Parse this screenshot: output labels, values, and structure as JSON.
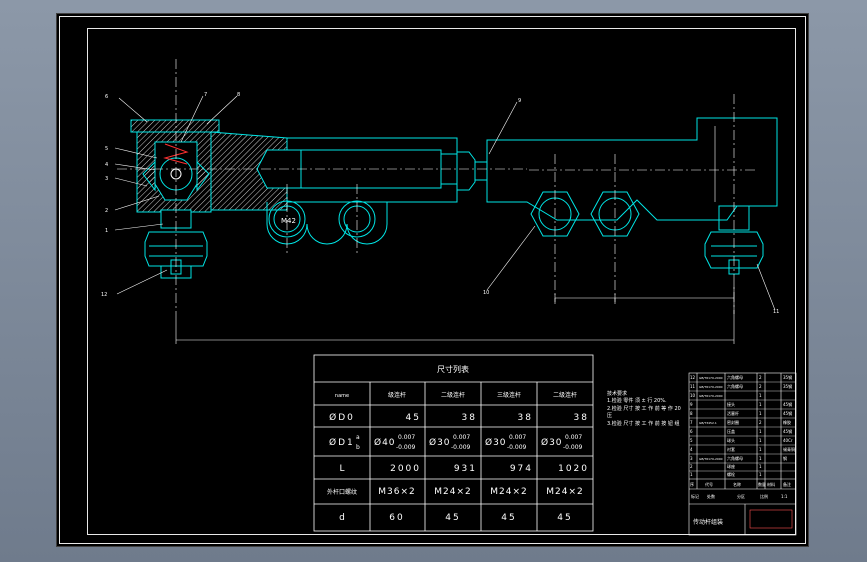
{
  "drawing": {
    "colors": {
      "background": "#000000",
      "part_outline": "#00e5e5",
      "hatch": "#ffffff",
      "centerline": "#ffffff",
      "leader": "#ffffff",
      "dim_line": "#ffffff"
    },
    "dimension_table": {
      "title": "尺寸列表",
      "header_first": "name",
      "headers": [
        "级连杆",
        "二级连杆",
        "三级连杆",
        "二级连杆"
      ],
      "rows": [
        {
          "label": "ØD0",
          "values": [
            "45",
            "38",
            "38",
            "38"
          ]
        },
        {
          "label": "ØD1",
          "label_sup": "a",
          "label_sub": "b",
          "tol_upper": "0.007",
          "tol_lower": "-0.009",
          "values": [
            "Ø40",
            "Ø30",
            "Ø30",
            "Ø30"
          ]
        },
        {
          "label": "L",
          "values": [
            "2000",
            "931",
            "974",
            "1020"
          ]
        },
        {
          "label": "外杆口螺纹",
          "values": [
            "M36×2",
            "M24×2",
            "M24×2",
            "M24×2"
          ]
        },
        {
          "label": "d",
          "values": [
            "60",
            "45",
            "45",
            "45"
          ]
        }
      ]
    },
    "notes": {
      "title": "技术要求",
      "lines": [
        "1.检验 零件 须 ± 行 20%.",
        "2.检验 尺寸 按 工 作 前 等 作 20",
        "压",
        "3.检验 尺寸 按 工 作 前 按 钮 组"
      ]
    },
    "callouts": [
      "6",
      "7",
      "8",
      "5",
      "4",
      "3",
      "2",
      "1",
      "12",
      "9",
      "10",
      "11"
    ],
    "thread_label": "M42",
    "title_block": {
      "drawing_name": "传动杆组装",
      "material_row": [
        "序",
        "代号",
        "名称",
        "数量",
        "材料",
        "备注"
      ],
      "rows": [
        [
          "12",
          "GB/T6170-2000",
          "六角螺母",
          "2",
          "",
          "35钢"
        ],
        [
          "11",
          "GB/T6170-2000",
          "六角螺母",
          "2",
          "",
          "35钢"
        ],
        [
          "10",
          "GB/T6170-2000",
          "",
          "1",
          "",
          ""
        ],
        [
          "9",
          "",
          "接头",
          "1",
          "",
          "45钢"
        ],
        [
          "8",
          "",
          "活塞杆",
          "1",
          "",
          "45钢"
        ],
        [
          "7",
          "GB/T3452.1",
          "密封圈",
          "2",
          "",
          "橡胶"
        ],
        [
          "6",
          "",
          "压盖",
          "1",
          "",
          "45钢"
        ],
        [
          "5",
          "",
          "球头",
          "1",
          "",
          "40Cr"
        ],
        [
          "4",
          "",
          "衬套",
          "1",
          "",
          "锡青铜"
        ],
        [
          "3",
          "GB/T6170-2000",
          "六角螺母",
          "1",
          "",
          "钢"
        ],
        [
          "2",
          "",
          "球座",
          "1",
          "",
          ""
        ],
        [
          "1",
          "",
          "螺栓",
          "1",
          "",
          ""
        ]
      ],
      "footer": [
        "标记",
        "处数",
        "分区",
        "比例",
        "1:1"
      ]
    }
  }
}
